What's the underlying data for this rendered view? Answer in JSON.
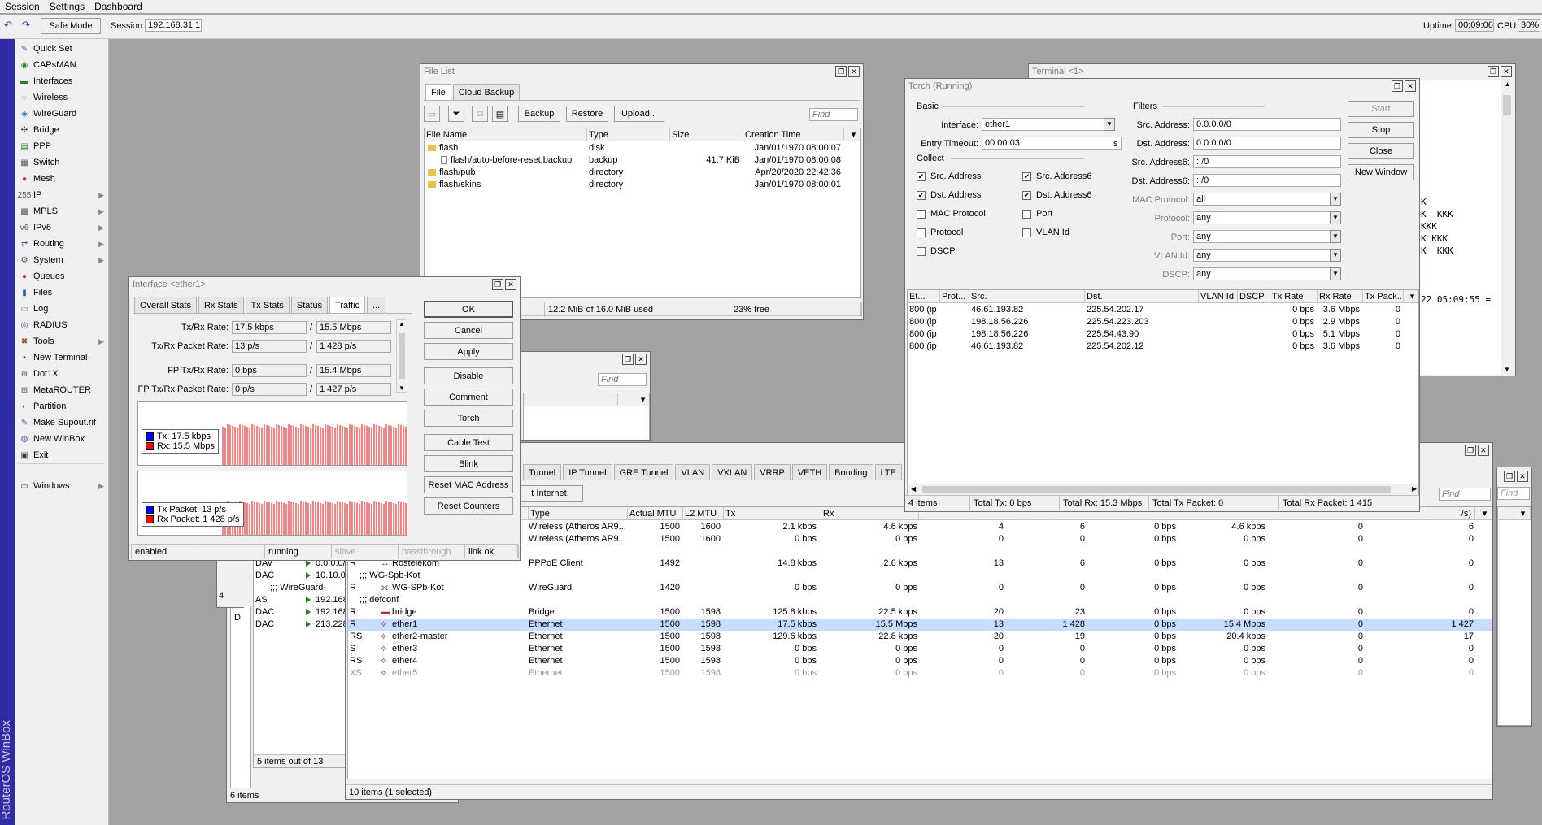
{
  "menu": [
    "Session",
    "Settings",
    "Dashboard"
  ],
  "toolbar": {
    "safe_mode": "Safe Mode",
    "session_label": "Session:",
    "session_value": "192.168.31.1",
    "uptime_label": "Uptime:",
    "uptime_value": "00:09:06",
    "cpu_label": "CPU:",
    "cpu_value": "30%"
  },
  "brand": "RouterOS WinBox",
  "sidebar": [
    {
      "label": "Quick Set",
      "icon": "quick-set-icon",
      "glyph": "✎",
      "color": "#3a6ab8",
      "arrow": false
    },
    {
      "label": "CAPsMAN",
      "icon": "capsman-icon",
      "glyph": "◉",
      "color": "#2c8a2c",
      "arrow": false
    },
    {
      "label": "Interfaces",
      "icon": "interfaces-icon",
      "glyph": "▬",
      "color": "#2c7a2c",
      "arrow": false
    },
    {
      "label": "Wireless",
      "icon": "wireless-icon",
      "glyph": "◌",
      "color": "#555",
      "arrow": false
    },
    {
      "label": "WireGuard",
      "icon": "wireguard-icon",
      "glyph": "◈",
      "color": "#2a6ab0",
      "arrow": false
    },
    {
      "label": "Bridge",
      "icon": "bridge-icon",
      "glyph": "✣",
      "color": "#333",
      "arrow": false
    },
    {
      "label": "PPP",
      "icon": "ppp-icon",
      "glyph": "▤",
      "color": "#2a7a2a",
      "arrow": false
    },
    {
      "label": "Switch",
      "icon": "switch-icon",
      "glyph": "▦",
      "color": "#555",
      "arrow": false
    },
    {
      "label": "Mesh",
      "icon": "mesh-icon",
      "glyph": "●",
      "color": "#c03030",
      "arrow": false
    },
    {
      "label": "IP",
      "icon": "ip-icon",
      "glyph": "255",
      "color": "#555",
      "arrow": true
    },
    {
      "label": "MPLS",
      "icon": "mpls-icon",
      "glyph": "▩",
      "color": "#555",
      "arrow": true
    },
    {
      "label": "IPv6",
      "icon": "ipv6-icon",
      "glyph": "v6",
      "color": "#555",
      "arrow": true
    },
    {
      "label": "Routing",
      "icon": "routing-icon",
      "glyph": "⇄",
      "color": "#3a5ab0",
      "arrow": true
    },
    {
      "label": "System",
      "icon": "system-icon",
      "glyph": "⚙",
      "color": "#555",
      "arrow": true
    },
    {
      "label": "Queues",
      "icon": "queues-icon",
      "glyph": "●",
      "color": "#c03030",
      "arrow": false
    },
    {
      "label": "Files",
      "icon": "files-icon",
      "glyph": "▮",
      "color": "#2a5ab0",
      "arrow": false
    },
    {
      "label": "Log",
      "icon": "log-icon",
      "glyph": "▭",
      "color": "#777",
      "arrow": false
    },
    {
      "label": "RADIUS",
      "icon": "radius-icon",
      "glyph": "◎",
      "color": "#3a5ab0",
      "arrow": false
    },
    {
      "label": "Tools",
      "icon": "tools-icon",
      "glyph": "✖",
      "color": "#a05020",
      "arrow": true
    },
    {
      "label": "New Terminal",
      "icon": "terminal-icon",
      "glyph": "▪",
      "color": "#222",
      "arrow": false
    },
    {
      "label": "Dot1X",
      "icon": "dot1x-icon",
      "glyph": "⊕",
      "color": "#555",
      "arrow": false
    },
    {
      "label": "MetaROUTER",
      "icon": "metarouter-icon",
      "glyph": "⊞",
      "color": "#555",
      "arrow": false
    },
    {
      "label": "Partition",
      "icon": "partition-icon",
      "glyph": "◐",
      "color": "#3a5ab0",
      "arrow": false
    },
    {
      "label": "Make Supout.rif",
      "icon": "supout-icon",
      "glyph": "✎",
      "color": "#3a5ab0",
      "arrow": false
    },
    {
      "label": "New WinBox",
      "icon": "winbox-icon",
      "glyph": "◍",
      "color": "#3a5ab0",
      "arrow": false
    },
    {
      "label": "Exit",
      "icon": "exit-icon",
      "glyph": "▣",
      "color": "#333",
      "arrow": false
    },
    {
      "label": "Windows",
      "icon": "windows-icon",
      "glyph": "▭",
      "color": "#555",
      "arrow": true
    }
  ],
  "file_list": {
    "title": "File List",
    "tabs": [
      "File",
      "Cloud Backup"
    ],
    "buttons": [
      "Backup",
      "Restore",
      "Upload..."
    ],
    "find_placeholder": "Find",
    "columns": [
      "File Name",
      "Type",
      "Size",
      "Creation Time"
    ],
    "rows": [
      {
        "name": "flash",
        "type": "disk",
        "size": "",
        "time": "Jan/01/1970 08:00:07",
        "icon": "folder"
      },
      {
        "name": "flash/auto-before-reset.backup",
        "type": "backup",
        "size": "41.7 KiB",
        "time": "Jan/01/1970 08:00:08",
        "icon": "doc"
      },
      {
        "name": "flash/pub",
        "type": "directory",
        "size": "",
        "time": "Apr/20/2020 22:42:36",
        "icon": "folder"
      },
      {
        "name": "flash/skins",
        "type": "directory",
        "size": "",
        "time": "Jan/01/1970 08:00:01",
        "icon": "folder"
      }
    ],
    "status_used": "12.2 MiB of 16.0 MiB used",
    "status_free": "23% free"
  },
  "terminal": {
    "title": "Terminal <1>",
    "lines": [
      "K",
      "K  KKK",
      "KKK",
      "K KKK",
      "K  KKK",
      "",
      "",
      "",
      "22 05:09:55 ="
    ]
  },
  "torch": {
    "title": "Torch (Running)",
    "basic_label": "Basic",
    "interface_label": "Interface:",
    "interface_value": "ether1",
    "timeout_label": "Entry Timeout:",
    "timeout_value": "00:00:03",
    "timeout_unit": "s",
    "collect_label": "Collect",
    "checks": [
      {
        "label": "Src. Address",
        "checked": true
      },
      {
        "label": "Src. Address6",
        "checked": true
      },
      {
        "label": "Dst. Address",
        "checked": true
      },
      {
        "label": "Dst. Address6",
        "checked": true
      },
      {
        "label": "MAC Protocol",
        "checked": false
      },
      {
        "label": "Port",
        "checked": false
      },
      {
        "label": "Protocol",
        "checked": false
      },
      {
        "label": "VLAN Id",
        "checked": false
      },
      {
        "label": "DSCP",
        "checked": false
      }
    ],
    "filters_label": "Filters",
    "filters": [
      {
        "label": "Src. Address:",
        "value": "0.0.0.0/0",
        "dd": false
      },
      {
        "label": "Dst. Address:",
        "value": "0.0.0.0/0",
        "dd": false
      },
      {
        "label": "Src. Address6:",
        "value": "::/0",
        "dd": false
      },
      {
        "label": "Dst. Address6:",
        "value": "::/0",
        "dd": false
      },
      {
        "label": "MAC Protocol:",
        "value": "all",
        "dd": true
      },
      {
        "label": "Protocol:",
        "value": "any",
        "dd": true
      },
      {
        "label": "Port:",
        "value": "any",
        "dd": true
      },
      {
        "label": "VLAN Id:",
        "value": "any",
        "dd": true
      },
      {
        "label": "DSCP:",
        "value": "any",
        "dd": true
      }
    ],
    "buttons": [
      "Start",
      "Stop",
      "Close",
      "New Window"
    ],
    "columns": [
      "Et...",
      "Prot...",
      "Src.",
      "Dst.",
      "VLAN Id",
      "DSCP",
      "Tx Rate",
      "Rx Rate",
      "Tx Pack..."
    ],
    "rows": [
      [
        "800 (ip)",
        "",
        "46.61.193.82",
        "225.54.202.17",
        "",
        "",
        "0 bps",
        "3.6 Mbps",
        "0"
      ],
      [
        "800 (ip)",
        "",
        "198.18.56.226",
        "225.54.223.203",
        "",
        "",
        "0 bps",
        "2.9 Mbps",
        "0"
      ],
      [
        "800 (ip)",
        "",
        "198.18.56.226",
        "225.54.43.90",
        "",
        "",
        "0 bps",
        "5.1 Mbps",
        "0"
      ],
      [
        "800 (ip)",
        "",
        "46.61.193.82",
        "225.54.202.12",
        "",
        "",
        "0 bps",
        "3.6 Mbps",
        "0"
      ]
    ],
    "status": [
      "4 items",
      "Total Tx: 0 bps",
      "Total Rx: 15.3 Mbps",
      "Total Tx Packet: 0",
      "Total Rx Packet: 1 415"
    ]
  },
  "iface_win": {
    "title": "Interface <ether1>",
    "tabs": [
      "Overall Stats",
      "Rx Stats",
      "Tx Stats",
      "Status",
      "Traffic",
      "..."
    ],
    "rows": [
      {
        "label": "Tx/Rx Rate:",
        "a": "17.5 kbps",
        "b": "15.5 Mbps"
      },
      {
        "label": "Tx/Rx Packet Rate:",
        "a": "13 p/s",
        "b": "1 428 p/s"
      },
      {
        "label": "FP Tx/Rx Rate:",
        "a": "0 bps",
        "b": "15.4 Mbps"
      },
      {
        "label": "FP Tx/Rx Packet Rate:",
        "a": "0 p/s",
        "b": "1 427 p/s"
      }
    ],
    "legend1": {
      "tx": "Tx:  17.5 kbps",
      "rx": "Rx:  15.5 Mbps"
    },
    "legend2": {
      "tx": "Tx Packet:  13 p/s",
      "rx": "Rx Packet:  1 428 p/s"
    },
    "colors": {
      "tx": "#0000ff",
      "rx": "#ff0000"
    },
    "buttons": [
      "OK",
      "Cancel",
      "Apply",
      "Disable",
      "Comment",
      "Torch",
      "Cable Test",
      "Blink",
      "Reset MAC Address",
      "Reset Counters"
    ],
    "status": [
      "enabled",
      "",
      "running",
      "slave",
      "passthrough",
      "link ok"
    ]
  },
  "small_win": {
    "find_placeholder": "Find"
  },
  "routes_win": {
    "rows": [
      {
        "flag": "DAv",
        "dst": "0.0.0.0/"
      },
      {
        "flag": "DAC",
        "dst": "10.10.0"
      },
      {
        "flag": "",
        "dst": ";;; WireGuard-SPb-K"
      },
      {
        "flag": "AS",
        "dst": "192.168"
      },
      {
        "flag": "DAC",
        "dst": "192.168"
      },
      {
        "flag": "DAC",
        "dst": "213.228"
      }
    ],
    "status_left": "4 items",
    "status_mid": "5 items out of 13",
    "status_bottom": "6 items",
    "mark_d": "D"
  },
  "interfaces": {
    "tabs": [
      "Tunnel",
      "IP Tunnel",
      "GRE Tunnel",
      "VLAN",
      "VXLAN",
      "VRRP",
      "VETH",
      "Bonding",
      "LTE",
      "VRF"
    ],
    "sub_button": "t Internet",
    "find_placeholder": "Find",
    "columns": [
      "Type",
      "Actual MTU",
      "L2 MTU",
      "Tx",
      "Rx"
    ],
    "extra_col": "/s)",
    "rows": [
      {
        "flag": "",
        "name": "",
        "type": "Wireless (Atheros AR9...",
        "mtu": "1500",
        "l2": "1600",
        "tx": "2.1 kbps",
        "rx": "4.6 kbps",
        "c1": "4",
        "c2": "6",
        "c3": "0 bps",
        "c4": "4.6 kbps",
        "c5": "0",
        "c6": "6",
        "kind": "row"
      },
      {
        "flag": "",
        "name": "",
        "type": "Wireless (Atheros AR9...",
        "mtu": "1500",
        "l2": "1600",
        "tx": "0 bps",
        "rx": "0 bps",
        "c1": "0",
        "c2": "0",
        "c3": "0 bps",
        "c4": "0 bps",
        "c5": "0",
        "c6": "0",
        "kind": "row"
      },
      {
        "name": ";;; Internet",
        "kind": "comment"
      },
      {
        "flag": "R",
        "name": "Rostelekom",
        "type": "PPPoE Client",
        "mtu": "1492",
        "l2": "",
        "tx": "14.8 kbps",
        "rx": "2.6 kbps",
        "c1": "13",
        "c2": "6",
        "c3": "0 bps",
        "c4": "0 bps",
        "c5": "0",
        "c6": "0",
        "kind": "row",
        "icon": "pppoe"
      },
      {
        "name": ";;; WG-Spb-Kot",
        "kind": "comment"
      },
      {
        "flag": "R",
        "name": "WG-SPb-Kot",
        "type": "WireGuard",
        "mtu": "1420",
        "l2": "",
        "tx": "0 bps",
        "rx": "0 bps",
        "c1": "0",
        "c2": "0",
        "c3": "0 bps",
        "c4": "0 bps",
        "c5": "0",
        "c6": "0",
        "kind": "row",
        "icon": "wg"
      },
      {
        "name": ";;; defconf",
        "kind": "comment"
      },
      {
        "flag": "R",
        "name": "bridge",
        "type": "Bridge",
        "mtu": "1500",
        "l2": "1598",
        "tx": "125.8 kbps",
        "rx": "22.5 kbps",
        "c1": "20",
        "c2": "23",
        "c3": "0 bps",
        "c4": "0 bps",
        "c5": "0",
        "c6": "0",
        "kind": "row",
        "icon": "bridge"
      },
      {
        "flag": "R",
        "name": "ether1",
        "type": "Ethernet",
        "mtu": "1500",
        "l2": "1598",
        "tx": "17.5 kbps",
        "rx": "15.5 Mbps",
        "c1": "13",
        "c2": "1 428",
        "c3": "0 bps",
        "c4": "15.4 Mbps",
        "c5": "0",
        "c6": "1 427",
        "kind": "row",
        "selected": true,
        "icon": "eth"
      },
      {
        "flag": "RS",
        "name": "ether2-master",
        "type": "Ethernet",
        "mtu": "1500",
        "l2": "1598",
        "tx": "129.6 kbps",
        "rx": "22.8 kbps",
        "c1": "20",
        "c2": "19",
        "c3": "0 bps",
        "c4": "20.4 kbps",
        "c5": "0",
        "c6": "17",
        "kind": "row",
        "icon": "eth"
      },
      {
        "flag": "S",
        "name": "ether3",
        "type": "Ethernet",
        "mtu": "1500",
        "l2": "1598",
        "tx": "0 bps",
        "rx": "0 bps",
        "c1": "0",
        "c2": "0",
        "c3": "0 bps",
        "c4": "0 bps",
        "c5": "0",
        "c6": "0",
        "kind": "row",
        "icon": "eth"
      },
      {
        "flag": "RS",
        "name": "ether4",
        "type": "Ethernet",
        "mtu": "1500",
        "l2": "1598",
        "tx": "0 bps",
        "rx": "0 bps",
        "c1": "0",
        "c2": "0",
        "c3": "0 bps",
        "c4": "0 bps",
        "c5": "0",
        "c6": "0",
        "kind": "row",
        "icon": "eth"
      },
      {
        "flag": "XS",
        "name": "ether5",
        "type": "Ethernet",
        "mtu": "1500",
        "l2": "1598",
        "tx": "0 bps",
        "rx": "0 bps",
        "c1": "0",
        "c2": "0",
        "c3": "0 bps",
        "c4": "0 bps",
        "c5": "0",
        "c6": "0",
        "kind": "row",
        "dim": true,
        "icon": "eth"
      }
    ],
    "status": "10 items (1 selected)"
  }
}
